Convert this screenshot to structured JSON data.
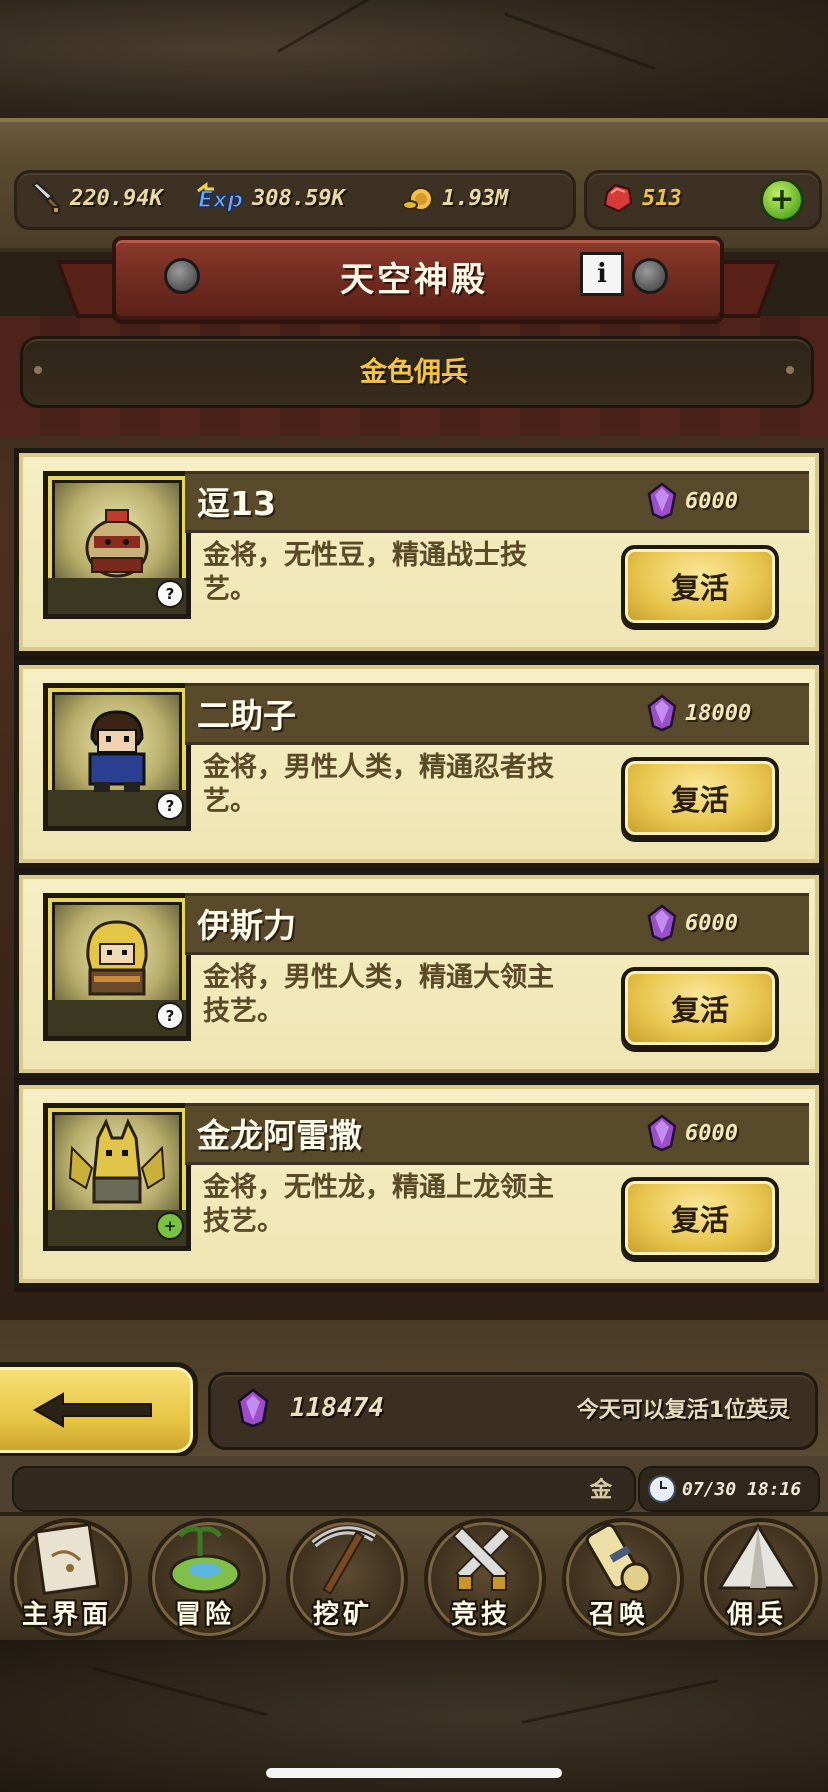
{
  "resources": {
    "attack": "220.94K",
    "exp": "308.59K",
    "gold": "1.93M",
    "gems": "513"
  },
  "header": {
    "title": "天空神殿",
    "info_glyph": "i"
  },
  "subtitle": "金色佣兵",
  "heroes": [
    {
      "name": "逗13",
      "cost": "6000",
      "desc": "金将，无性豆，精通战士技艺。",
      "button": "复活",
      "badge": "?"
    },
    {
      "name": "二助子",
      "cost": "18000",
      "desc": "金将，男性人类，精通忍者技艺。",
      "button": "复活",
      "badge": "?"
    },
    {
      "name": "伊斯力",
      "cost": "6000",
      "desc": "金将，男性人类，精通大领主技艺。",
      "button": "复活",
      "badge": "?"
    },
    {
      "name": "金龙阿雷撒",
      "cost": "6000",
      "desc": "金将，无性龙，精通上龙领主技艺。",
      "button": "复活",
      "badge": "+"
    }
  ],
  "footer": {
    "gem_total": "118474",
    "revive_note": "今天可以复活1位英灵"
  },
  "chat": {
    "preview": "金",
    "time": "07/30 18:16"
  },
  "nav": [
    {
      "label": "主界面",
      "icon": "scroll-map-icon"
    },
    {
      "label": "冒险",
      "icon": "island-icon"
    },
    {
      "label": "挖矿",
      "icon": "pickaxe-icon"
    },
    {
      "label": "竞技",
      "icon": "crossed-swords-icon"
    },
    {
      "label": "召唤",
      "icon": "summon-scroll-icon"
    },
    {
      "label": "佣兵",
      "icon": "tent-icon"
    }
  ]
}
